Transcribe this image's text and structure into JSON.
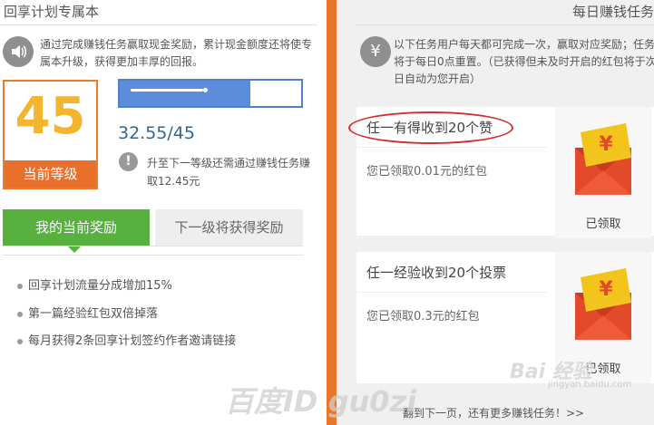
{
  "left_panel": {
    "title": "回享计划专属本",
    "intro_icon": "speaker-icon",
    "intro_text": "通过完成赚钱任务赢取现金奖励，累计现金额度还将使专属本升级，获得更加丰厚的回报。",
    "level": {
      "number": "45",
      "label": "当前等级"
    },
    "progress": {
      "value_text": "32.55/45",
      "fraction": 0.72,
      "color": "#5b8ddb"
    },
    "upgrade_note": "升至下一等级还需通过赚钱任务赚取12.45元",
    "tabs": [
      {
        "label": "我的当前奖励",
        "active": true
      },
      {
        "label": "下一级将获得奖励",
        "active": false
      }
    ],
    "rewards": [
      "回享计划流量分成增加15%",
      "第一篇经验红包双倍掉落",
      "每月获得2条回享计划签约作者邀请链接"
    ]
  },
  "right_panel": {
    "title": "每日赚钱任务",
    "intro_icon": "yen-icon",
    "intro_text": "以下任务用户每天都可完成一次，赢取对应奖励；任务将于每日0点重置。（已获得但未及时开启的红包将于次日自动为您开启）",
    "tasks": [
      {
        "title": "任一有得收到20个赞",
        "desc": "您已领取0.01元的红包",
        "status": "已领取",
        "envelope_icon": "red-envelope-icon",
        "highlighted": true
      },
      {
        "title": "任一经验收到20个投票",
        "desc": "您已领取0.3元的红包",
        "status": "已领取",
        "envelope_icon": "red-envelope-icon",
        "highlighted": false
      }
    ],
    "more_link": "翻到下一页，还有更多赚钱任务！>>"
  },
  "watermarks": {
    "author": "百度ID gu0zi",
    "brand": "Bai 经验",
    "brand_sub": "jingyan.baidu.com"
  },
  "colors": {
    "accent_orange": "#e8702a",
    "level_gold": "#f3b52d",
    "tab_green": "#58b03e",
    "progress_blue": "#4e7fd1",
    "envelope_red": "#e34a2a",
    "envelope_gold": "#f3c51c"
  }
}
